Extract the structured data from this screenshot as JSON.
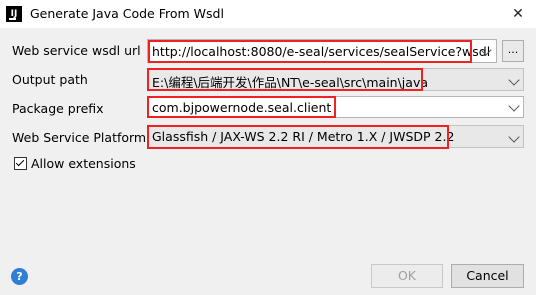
{
  "window": {
    "app_icon_text": "IJ",
    "title": "Generate Java Code From Wsdl",
    "close_glyph": "✕"
  },
  "form": {
    "wsdl_url": {
      "label": "Web service wsdl url",
      "value": "http://localhost:8080/e-seal/services/sealService?wsdl",
      "browse_label": "..."
    },
    "output_path": {
      "label": "Output path",
      "value": "E:\\编程\\后端开发\\作品\\NT\\e-seal\\src\\main\\java"
    },
    "package_prefix": {
      "label": "Package prefix",
      "value": "com.bjpowernode.seal.client"
    },
    "platform": {
      "label": "Web Service Platform",
      "value": "Glassfish / JAX-WS 2.2 RI / Metro 1.X / JWSDP 2.2"
    },
    "allow_extensions": {
      "label": "Allow extensions",
      "checked": true
    }
  },
  "footer": {
    "help_glyph": "?",
    "ok_label": "OK",
    "cancel_label": "Cancel"
  },
  "colors": {
    "highlight": "#ee2222",
    "help": "#2f7fd6"
  },
  "icons": [
    "app-icon",
    "close-icon",
    "chevron-down-icon",
    "check-icon",
    "help-icon"
  ]
}
